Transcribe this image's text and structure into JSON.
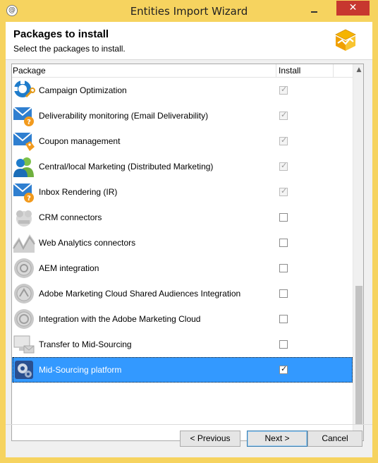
{
  "window": {
    "title": "Entities Import Wizard",
    "close_label": "✕"
  },
  "header": {
    "title": "Packages to install",
    "subtitle": "Select the packages to install."
  },
  "table": {
    "columns": [
      "Package",
      "Install"
    ],
    "rows": [
      {
        "label": "Campaign Optimization",
        "icon": "campaign-optimization-icon",
        "checked": true,
        "disabled": true
      },
      {
        "label": "Deliverability monitoring (Email Deliverability)",
        "icon": "deliverability-icon",
        "checked": true,
        "disabled": true
      },
      {
        "label": "Coupon management",
        "icon": "coupon-icon",
        "checked": true,
        "disabled": true
      },
      {
        "label": "Central/local Marketing (Distributed Marketing)",
        "icon": "distributed-marketing-icon",
        "checked": true,
        "disabled": true
      },
      {
        "label": "Inbox Rendering (IR)",
        "icon": "inbox-rendering-icon",
        "checked": true,
        "disabled": true
      },
      {
        "label": "CRM connectors",
        "icon": "crm-connectors-icon",
        "checked": false,
        "disabled": false
      },
      {
        "label": "Web Analytics connectors",
        "icon": "web-analytics-icon",
        "checked": false,
        "disabled": false
      },
      {
        "label": "AEM integration",
        "icon": "aem-icon",
        "checked": false,
        "disabled": false
      },
      {
        "label": "Adobe Marketing Cloud Shared Audiences Integration",
        "icon": "shared-audiences-icon",
        "checked": false,
        "disabled": false
      },
      {
        "label": "Integration with the Adobe Marketing Cloud",
        "icon": "marketing-cloud-icon",
        "checked": false,
        "disabled": false
      },
      {
        "label": "Transfer to Mid-Sourcing",
        "icon": "mid-sourcing-transfer-icon",
        "checked": false,
        "disabled": false
      },
      {
        "label": "Mid-Sourcing platform",
        "icon": "mid-sourcing-platform-icon",
        "checked": true,
        "disabled": false,
        "selected": true
      }
    ]
  },
  "footer": {
    "previous_label": "< Previous",
    "next_label": "Next >",
    "cancel_label": "Cancel"
  },
  "colors": {
    "title_bar": "#f6d35f",
    "selection": "#3399ff",
    "close_button": "#c7372f"
  }
}
